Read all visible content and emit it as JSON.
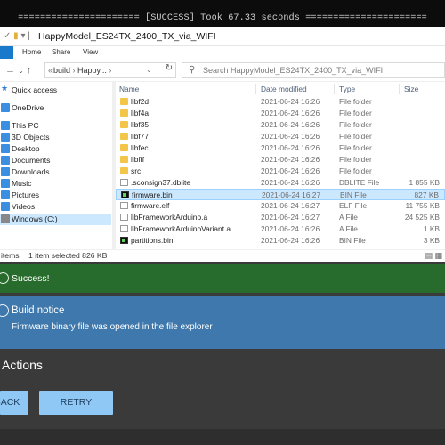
{
  "terminal": {
    "line": "====================== [SUCCESS] Took 67.33 seconds ======================"
  },
  "explorer": {
    "title": "HappyModel_ES24TX_2400_TX_via_WIFI",
    "ribbon": {
      "home": "Home",
      "share": "Share",
      "view": "View"
    },
    "address": {
      "parent": "build",
      "current": "Happy..."
    },
    "search_placeholder": "Search HappyModel_ES24TX_2400_TX_via_WIFI",
    "nav": [
      {
        "label": "Quick access",
        "icon": "star-icon"
      },
      {
        "label": "OneDrive",
        "icon": "cloud-icon"
      },
      {
        "label": "This PC",
        "icon": "computer-icon"
      },
      {
        "label": "3D Objects",
        "icon": "cube-icon"
      },
      {
        "label": "Desktop",
        "icon": "desktop-icon"
      },
      {
        "label": "Documents",
        "icon": "documents-icon"
      },
      {
        "label": "Downloads",
        "icon": "download-icon"
      },
      {
        "label": "Music",
        "icon": "music-icon"
      },
      {
        "label": "Pictures",
        "icon": "pictures-icon"
      },
      {
        "label": "Videos",
        "icon": "videos-icon"
      },
      {
        "label": "Windows (C:)",
        "icon": "drive-icon"
      }
    ],
    "columns": {
      "name": "Name",
      "date": "Date modified",
      "type": "Type",
      "size": "Size"
    },
    "files": [
      {
        "name": "libf2d",
        "date": "2021-06-24 16:26",
        "type": "File folder",
        "size": "",
        "kind": "folder"
      },
      {
        "name": "libf4a",
        "date": "2021-06-24 16:26",
        "type": "File folder",
        "size": "",
        "kind": "folder"
      },
      {
        "name": "libf35",
        "date": "2021-06-24 16:26",
        "type": "File folder",
        "size": "",
        "kind": "folder"
      },
      {
        "name": "libf77",
        "date": "2021-06-24 16:26",
        "type": "File folder",
        "size": "",
        "kind": "folder"
      },
      {
        "name": "libfec",
        "date": "2021-06-24 16:26",
        "type": "File folder",
        "size": "",
        "kind": "folder"
      },
      {
        "name": "libfff",
        "date": "2021-06-24 16:26",
        "type": "File folder",
        "size": "",
        "kind": "folder"
      },
      {
        "name": "src",
        "date": "2021-06-24 16:26",
        "type": "File folder",
        "size": "",
        "kind": "folder"
      },
      {
        "name": ".sconsign37.dblite",
        "date": "2021-06-24 16:26",
        "type": "DBLITE File",
        "size": "1 855 KB",
        "kind": "file"
      },
      {
        "name": "firmware.bin",
        "date": "2021-06-24 16:27",
        "type": "BIN File",
        "size": "827 KB",
        "kind": "term"
      },
      {
        "name": "firmware.elf",
        "date": "2021-06-24 16:27",
        "type": "ELF File",
        "size": "11 755 KB",
        "kind": "file"
      },
      {
        "name": "libFrameworkArduino.a",
        "date": "2021-06-24 16:27",
        "type": "A File",
        "size": "24 525 KB",
        "kind": "file"
      },
      {
        "name": "libFrameworkArduinoVariant.a",
        "date": "2021-06-24 16:26",
        "type": "A File",
        "size": "1 KB",
        "kind": "file"
      },
      {
        "name": "partitions.bin",
        "date": "2021-06-24 16:26",
        "type": "BIN File",
        "size": "3 KB",
        "kind": "term"
      }
    ],
    "selected_index": 8,
    "status": {
      "items": "items",
      "selected": "1 item selected  826 KB"
    }
  },
  "success": {
    "text": "Success!"
  },
  "notice": {
    "title": "Build notice",
    "message": "Firmware binary file was opened in the file explorer"
  },
  "actions": {
    "title": "Actions",
    "back": "BACK",
    "retry": "RETRY"
  }
}
